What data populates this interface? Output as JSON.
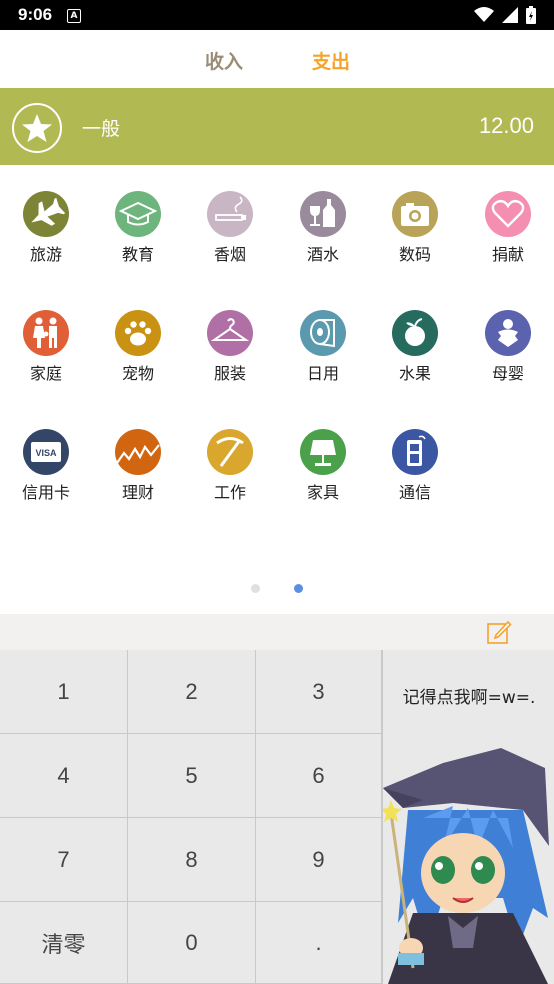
{
  "status": {
    "time": "9:06"
  },
  "tabs": {
    "income": "收入",
    "expense": "支出"
  },
  "selected": {
    "name": "一般",
    "amount": "12.00",
    "icon": "star-icon",
    "color": "#b1ba52"
  },
  "categories": [
    {
      "label": "旅游",
      "icon": "airplane-icon",
      "color": "#7d8436"
    },
    {
      "label": "教育",
      "icon": "graduation-cap-icon",
      "color": "#6db47d"
    },
    {
      "label": "香烟",
      "icon": "cigarette-icon",
      "color": "#c8b6c4"
    },
    {
      "label": "酒水",
      "icon": "wine-bottle-icon",
      "color": "#9a8b9c"
    },
    {
      "label": "数码",
      "icon": "camera-icon",
      "color": "#b9a359"
    },
    {
      "label": "捐献",
      "icon": "heart-icon",
      "color": "#f48fb1"
    },
    {
      "label": "家庭",
      "icon": "family-icon",
      "color": "#e05f36"
    },
    {
      "label": "宠物",
      "icon": "paw-icon",
      "color": "#c99212"
    },
    {
      "label": "服装",
      "icon": "hanger-icon",
      "color": "#b070a6"
    },
    {
      "label": "日用",
      "icon": "toilet-paper-icon",
      "color": "#5b9aae"
    },
    {
      "label": "水果",
      "icon": "apple-icon",
      "color": "#276b5f"
    },
    {
      "label": "母婴",
      "icon": "baby-icon",
      "color": "#5b62ae"
    },
    {
      "label": "信用卡",
      "icon": "visa-card-icon",
      "color": "#344667"
    },
    {
      "label": "理财",
      "icon": "chart-icon",
      "color": "#d2650f"
    },
    {
      "label": "工作",
      "icon": "pickaxe-icon",
      "color": "#d9a62e"
    },
    {
      "label": "家具",
      "icon": "lamp-icon",
      "color": "#4aa14a"
    },
    {
      "label": "通信",
      "icon": "phone-icon",
      "color": "#3b56a3"
    }
  ],
  "pager": {
    "active_color": "#5b8fe0",
    "inactive_color": "#e0e0e0"
  },
  "keypad": {
    "keys": [
      "1",
      "2",
      "3",
      "4",
      "5",
      "6",
      "7",
      "8",
      "9",
      "清零",
      "0",
      "."
    ],
    "reminder": "记得点我啊=w=."
  },
  "visa_text": "VISA"
}
